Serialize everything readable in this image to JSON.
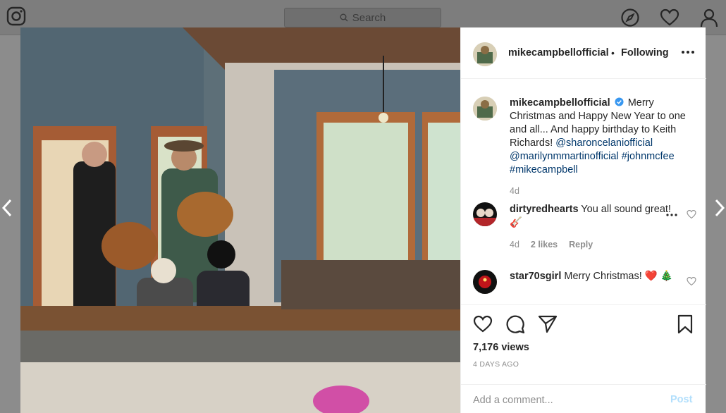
{
  "topbar": {
    "search_placeholder": "Search"
  },
  "post": {
    "username": "mikecampbellofficial",
    "separator": "•",
    "follow_status": "Following",
    "caption": {
      "username": "mikecampbellofficial",
      "verified": true,
      "text": "Merry Christmas and Happy New Year to one and all... And happy birthday to Keith Richards!",
      "mentions": [
        "@sharoncelaniofficial",
        "@marilynmmartinofficial",
        "#johnmcfee",
        "#mikecampbell"
      ],
      "age": "4d"
    },
    "comments": [
      {
        "username": "dirtyredhearts",
        "text": "You all sound great!🎸",
        "age": "4d",
        "likes": "2 likes",
        "reply": "Reply"
      },
      {
        "username": "star70sgirl",
        "text": "Merry Christmas! ❤️ 🎄"
      }
    ],
    "views": "7,176 views",
    "date": "4 DAYS AGO",
    "add_comment_placeholder": "Add a comment...",
    "post_button": "Post"
  },
  "colors": {
    "link": "#00376b",
    "muted": "#8e8e8e",
    "verified": "#3897f0",
    "post_disabled": "#b2dffc"
  },
  "icons": [
    "instagram-icon",
    "search-icon",
    "explore-icon",
    "heart-icon",
    "profile-icon",
    "prev-arrow-icon",
    "next-arrow-icon",
    "more-icon",
    "verified-icon",
    "like-icon",
    "comment-icon",
    "share-icon",
    "save-icon"
  ]
}
